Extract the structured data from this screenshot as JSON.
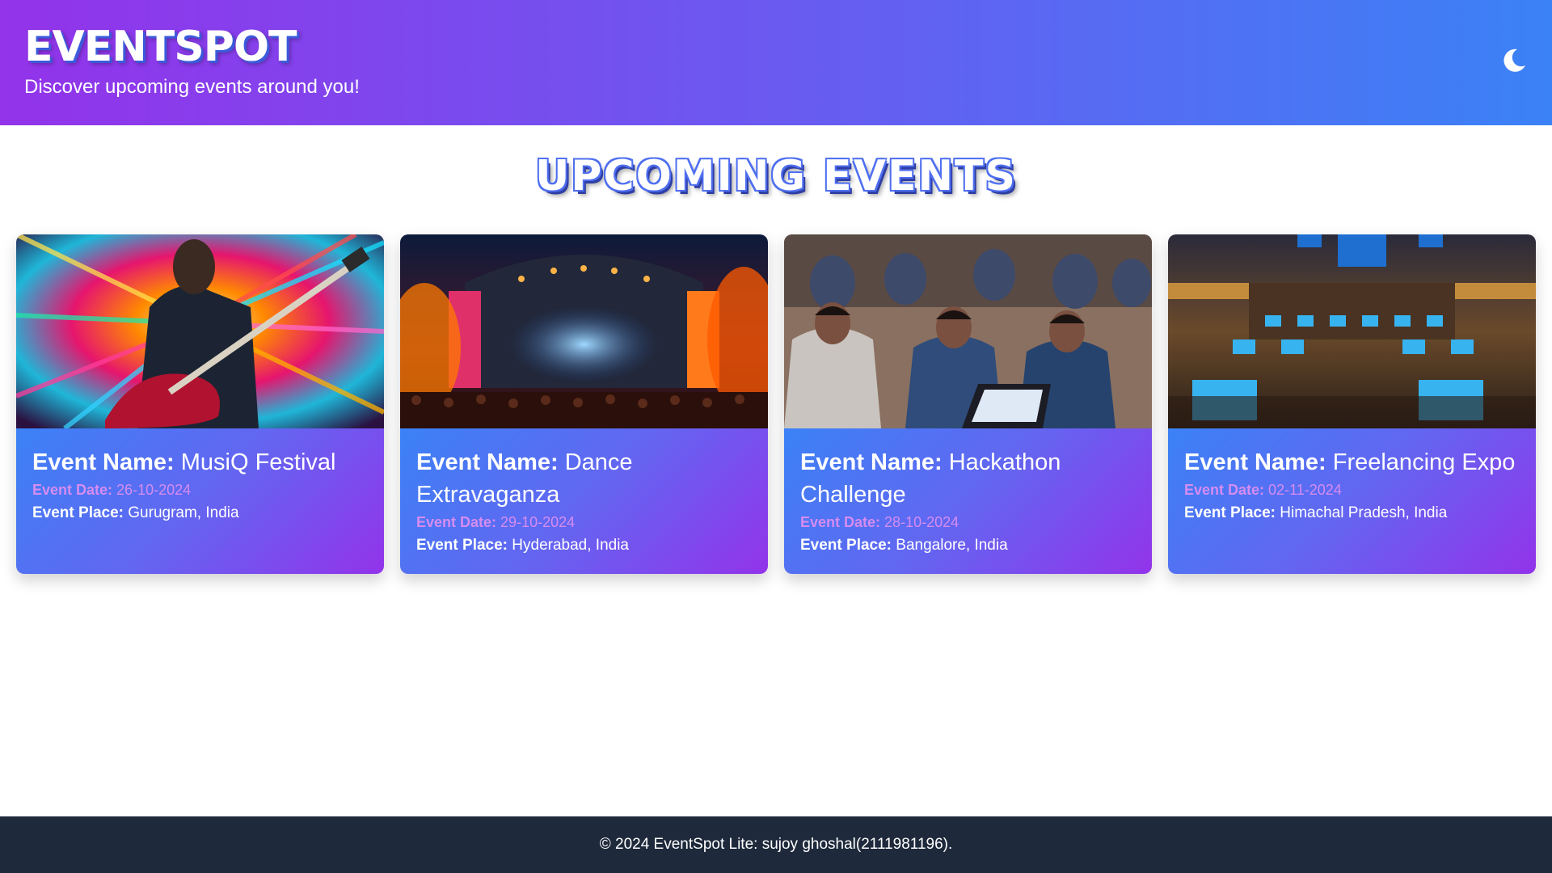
{
  "header": {
    "brand": "EVENTSPOT",
    "tagline": "Discover upcoming events around you!",
    "theme_icon": "moon-icon"
  },
  "main": {
    "section_title": "UPCOMING EVENTS",
    "events": [
      {
        "name_label": "Event Name:",
        "name": "MusiQ Festival",
        "date_label": "Event Date:",
        "date": "26-10-2024",
        "place_label": "Event Place:",
        "place": "Gurugram, India",
        "image": "guitarist-image"
      },
      {
        "name_label": "Event Name:",
        "name": "Dance Extravaganza",
        "date_label": "Event Date:",
        "date": "29-10-2024",
        "place_label": "Event Place:",
        "place": "Hyderabad, India",
        "image": "concert-stage-image"
      },
      {
        "name_label": "Event Name:",
        "name": "Hackathon Challenge",
        "date_label": "Event Date:",
        "date": "28-10-2024",
        "place_label": "Event Place:",
        "place": "Bangalore, India",
        "image": "hackathon-image"
      },
      {
        "name_label": "Event Name:",
        "name": "Freelancing Expo",
        "date_label": "Event Date:",
        "date": "02-11-2024",
        "place_label": "Event Place:",
        "place": "Himachal Pradesh, India",
        "image": "expo-hall-image"
      }
    ]
  },
  "footer": {
    "text": "© 2024 EventSpot Lite: sujoy ghoshal(2111981196)."
  },
  "colors": {
    "header_start": "#9333ea",
    "header_end": "#3b82f6",
    "card_start": "#3b82f6",
    "card_end": "#9333ea",
    "date_text": "#d58cf0",
    "footer_bg": "#1e293b"
  }
}
